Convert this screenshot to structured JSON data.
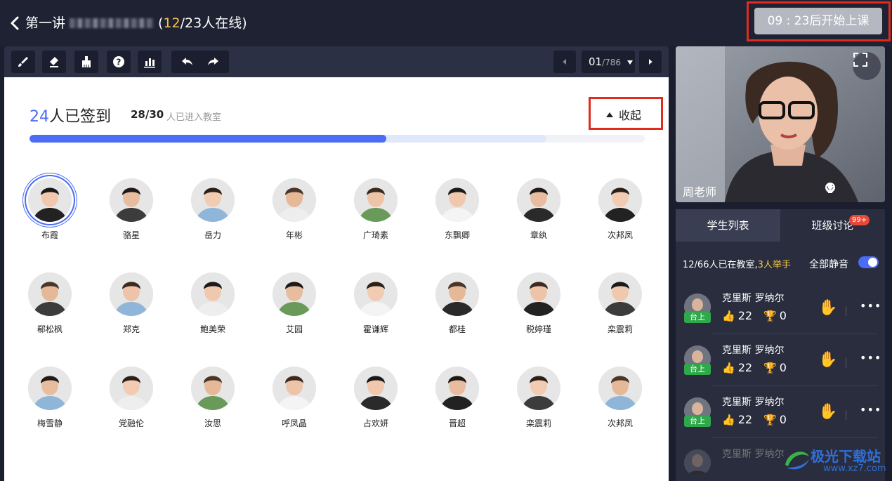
{
  "header": {
    "back_icon": "chevron-left-icon",
    "lecture": "第一讲",
    "online_open": "(",
    "online_current": "12",
    "online_total": "/23人在线)",
    "countdown": "09 : 23后开始上课"
  },
  "toolbar": {
    "tools": [
      "brush-icon",
      "eraser-icon",
      "clear-icon",
      "question-icon",
      "chart-icon",
      "undo-icon",
      "redo-icon"
    ],
    "page": "01",
    "page_total": "/786"
  },
  "attendance": {
    "signed_num": "24",
    "signed_label": "人已签到",
    "entered": "28/30",
    "entered_label": "人已进入教室",
    "collapse_label": "收起",
    "progress_signed": 0.58,
    "progress_entered": 0.84
  },
  "students": [
    {
      "name": "布霞"
    },
    {
      "name": "骆星"
    },
    {
      "name": "岳力"
    },
    {
      "name": "年彬"
    },
    {
      "name": "广琦素"
    },
    {
      "name": "东飘卿"
    },
    {
      "name": "章纨"
    },
    {
      "name": "次邦凤"
    },
    {
      "name": "郗松枫"
    },
    {
      "name": "郑克"
    },
    {
      "name": "鲍美荣"
    },
    {
      "name": "艾园"
    },
    {
      "name": "霍谦辉"
    },
    {
      "name": "都桂"
    },
    {
      "name": "税婷瑾"
    },
    {
      "name": "栾震莉"
    },
    {
      "name": "梅雪静"
    },
    {
      "name": "党融伦"
    },
    {
      "name": "汝思"
    },
    {
      "name": "呼凤晶"
    },
    {
      "name": "占欢妍"
    },
    {
      "name": "晋超"
    },
    {
      "name": "栾震莉"
    },
    {
      "name": "次邦凤"
    }
  ],
  "teacher": {
    "name": "周老师"
  },
  "side": {
    "tab_students": "学生列表",
    "tab_discussion": "班级讨论",
    "discussion_badge": "99+",
    "summary_prefix": "12/66人已在教室,",
    "summary_hands": "3人举手",
    "mute_all": "全部静音",
    "rows": [
      {
        "name": "克里斯 罗纳尔",
        "stage": "台上",
        "likes": "22",
        "trophies": "0"
      },
      {
        "name": "克里斯 罗纳尔",
        "stage": "台上",
        "likes": "22",
        "trophies": "0"
      },
      {
        "name": "克里斯 罗纳尔",
        "stage": "台上",
        "likes": "22",
        "trophies": "0"
      },
      {
        "name": "克里斯 罗纳尔"
      }
    ],
    "more": "•••"
  },
  "watermark": {
    "line1": "极光下载站",
    "line2": "www.xz7.com"
  },
  "colors": {
    "accent": "#4a6cf7",
    "highlight": "#e02b1d",
    "yellow": "#f5c542",
    "stage_green": "#2ea84a"
  }
}
